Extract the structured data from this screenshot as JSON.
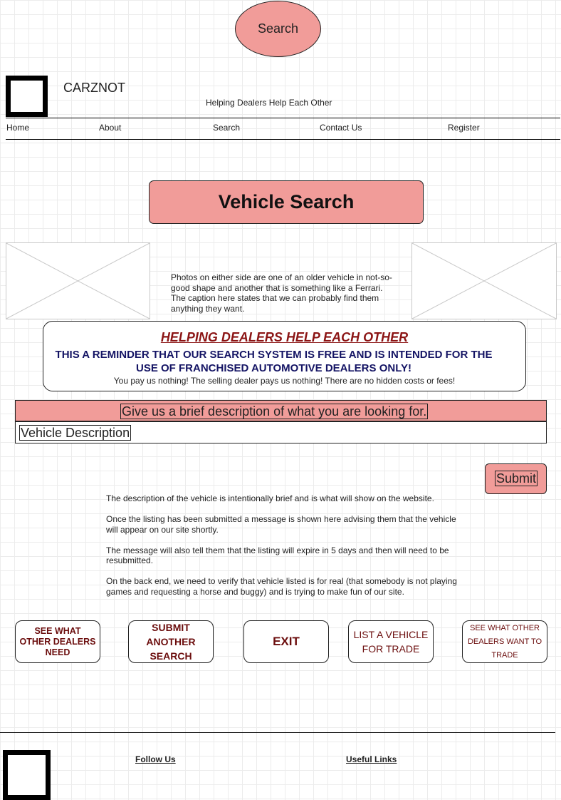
{
  "top_search": {
    "label": "Search"
  },
  "header": {
    "brand": "CARZNOT",
    "tagline": "Helping Dealers Help Each Other"
  },
  "nav": {
    "items": [
      {
        "label": "Home"
      },
      {
        "label": "About"
      },
      {
        "label": "Search"
      },
      {
        "label": "Contact Us"
      },
      {
        "label": "Register"
      }
    ]
  },
  "main": {
    "title": "Vehicle Search",
    "caption": "Photos on either side are one of an older vehicle in not-so-good shape and another that is something like a Ferrari. The caption here states that we can probably find them anything they want.",
    "reminder": {
      "heading": "HELPING DEALERS HELP EACH OTHER",
      "body": "THIS A REMINDER THAT OUR SEARCH SYSTEM IS FREE AND IS INTENDED FOR THE USE OF FRANCHISED AUTOMOTIVE DEALERS ONLY!",
      "footnote": "You pay us nothing! The selling dealer pays us nothing! There are no hidden costs or fees!"
    },
    "description_prompt": "Give us a brief description of what you are looking for.",
    "description_field": "Vehicle Description",
    "submit_label": "Submit",
    "notes": [
      "The description of the vehicle is intentionally brief and is what will show on the website.",
      "Once the listing has been submitted a message is shown here advising them that the vehicle will appear on our site shortly.",
      "The message will also tell them that the listing will expire in 5 days and then will need to be resubmitted.",
      "On the back end, we need to verify that vehicle listed is for real (that somebody is not playing games and requesting a horse and buggy) and is trying to make fun of our site."
    ]
  },
  "actions": [
    {
      "label": "SEE WHAT OTHER DEALERS NEED"
    },
    {
      "label": "SUBMIT ANOTHER SEARCH"
    },
    {
      "label": "EXIT"
    },
    {
      "label": "LIST A VEHICLE FOR TRADE"
    },
    {
      "label": "SEE WHAT OTHER DEALERS WANT TO TRADE"
    }
  ],
  "footer": {
    "follow_us": "Follow Us",
    "useful_links": "Useful Links"
  },
  "colors": {
    "accent_pink": "#f19c99",
    "heading_red": "#8b1414",
    "body_navy": "#141464",
    "button_text": "#6b0d0d"
  }
}
